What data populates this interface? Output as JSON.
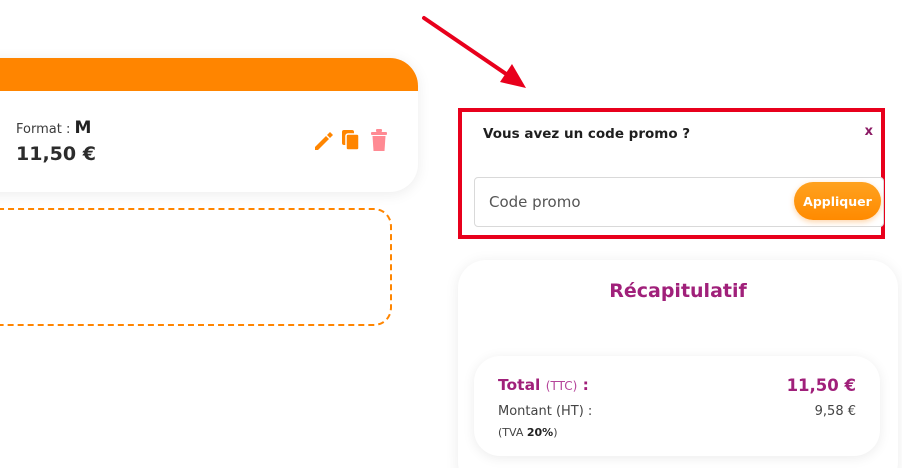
{
  "product": {
    "format_label": "Format :",
    "format_value": "M",
    "price": "11,50 €",
    "icons": [
      "pencil-icon",
      "copy-icon",
      "trash-icon"
    ]
  },
  "promo": {
    "title": "Vous avez un code promo ?",
    "close_label": "x",
    "placeholder": "Code promo",
    "value": "",
    "apply_label": "Appliquer"
  },
  "summary": {
    "title": "Récapitulatif",
    "total_label": "Total",
    "total_suffix": "(TTC)",
    "total_colon": ":",
    "total_value": "11,50 €",
    "ht_label": "Montant (HT) :",
    "ht_value": "9,58 €",
    "tva_prefix": "(TVA",
    "tva_rate": "20%",
    "tva_suffix": ")"
  },
  "colors": {
    "accent_orange": "#ff8500",
    "brand_magenta": "#a0207a",
    "highlight_red": "#e8001c",
    "trash_pink": "#ff8a93"
  }
}
